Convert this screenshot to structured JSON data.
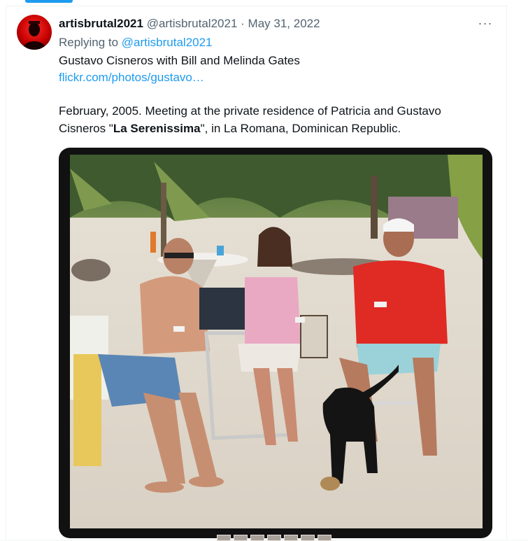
{
  "tweet": {
    "display_name": "artisbrutal2021",
    "handle": "@artisbrutal2021",
    "separator": "·",
    "date": "May 31, 2022",
    "more_label": "···",
    "reply_prefix": "Replying to",
    "reply_handle": "@artisbrutal2021",
    "text_line1": "Gustavo Cisneros with Bill and Melinda Gates",
    "link_text": "flickr.com/photos/gustavo…",
    "text_line2": "February, 2005. Meeting at the private residence of Patricia and Gustavo",
    "text_line3_pre": "Cisneros \"",
    "text_line3_bold": "La Serenissima",
    "text_line3_post": "\", in La Romana, Dominican Republic."
  },
  "icons": {
    "avatar": "silhouette-avatar-icon",
    "more": "more-dots-icon"
  },
  "colors": {
    "accent": "#1d9bf0",
    "muted": "#536471",
    "text": "#0f1419"
  }
}
